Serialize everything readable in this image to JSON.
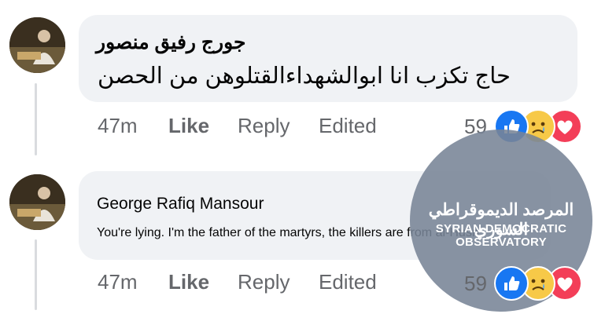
{
  "comments": [
    {
      "author": "جورج رفيق منصور",
      "text": "حاج تكزب انا ابوالشهداءالقتلوهن من الحصن",
      "actions": {
        "time": "47m",
        "like": "Like",
        "reply": "Reply",
        "edited": "Edited"
      },
      "reaction_count": "59",
      "reactions": [
        "like-emoji",
        "sad-emoji",
        "love-emoji"
      ]
    },
    {
      "author": "George Rafiq Mansour",
      "text": "You're lying. I'm the father of the martyrs, the killers are from al-Husn",
      "actions": {
        "time": "47m",
        "like": "Like",
        "reply": "Reply",
        "edited": "Edited"
      },
      "reaction_count": "59",
      "reactions": [
        "like-emoji",
        "sad-emoji",
        "love-emoji"
      ]
    }
  ],
  "watermark": {
    "arabic": "المرصد الديموقراطي السوري",
    "english": "SYRIAN DEMOCRATIC OBSERVATORY"
  },
  "colors": {
    "bubble": "#f0f2f5",
    "muted": "#65676b",
    "like_blue": "#1877f2",
    "love_red": "#f33e58",
    "sad_yellow": "#f7b928"
  }
}
